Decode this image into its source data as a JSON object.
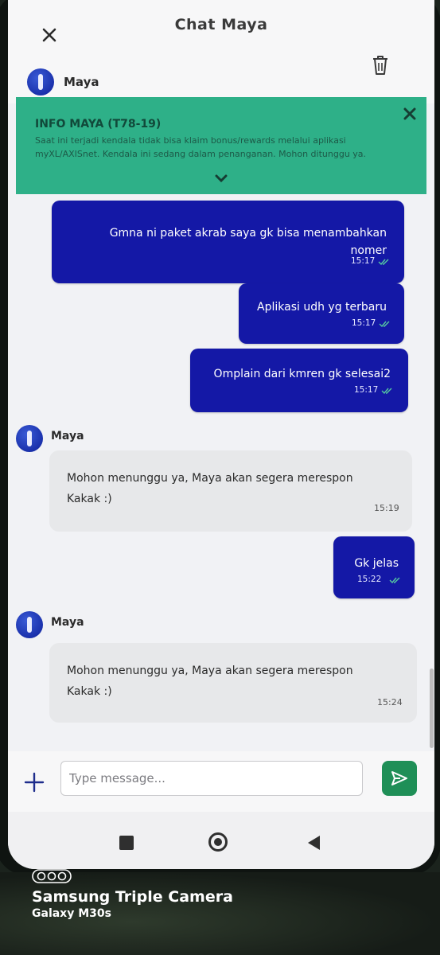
{
  "header": {
    "title": "Chat Maya",
    "agent_name": "Maya"
  },
  "info_banner": {
    "title": "INFO MAYA (T78-19)",
    "text": "Saat ini terjadi kendala tidak bisa klaim bonus/rewards melalui aplikasi myXL/AXISnet. Kendala ini sedang dalam penanganan. Mohon ditunggu ya."
  },
  "messages": [
    {
      "from": "user",
      "text": "Gmna ni paket akrab saya gk bisa menambahkan nomer",
      "time": "15:17"
    },
    {
      "from": "user",
      "text": "Aplikasi udh yg terbaru",
      "time": "15:17"
    },
    {
      "from": "user",
      "text": "Omplain dari kmren gk selesai2",
      "time": "15:17"
    },
    {
      "from": "agent",
      "sender": "Maya",
      "text": "Mohon menunggu ya, Maya akan segera merespon Kakak :)",
      "time": "15:19"
    },
    {
      "from": "user",
      "text": "Gk jelas",
      "time": "15:22"
    },
    {
      "from": "agent",
      "sender": "Maya",
      "text": "Mohon menunggu ya, Maya akan segera merespon Kakak :)",
      "time": "15:24"
    }
  ],
  "composer": {
    "placeholder": "Type message..."
  },
  "watermark": {
    "title": "Samsung Triple Camera",
    "subtitle": "Galaxy M30s"
  },
  "colors": {
    "user_bubble": "#1418a6",
    "banner": "#2eb088",
    "send_button": "#1f8f57"
  }
}
